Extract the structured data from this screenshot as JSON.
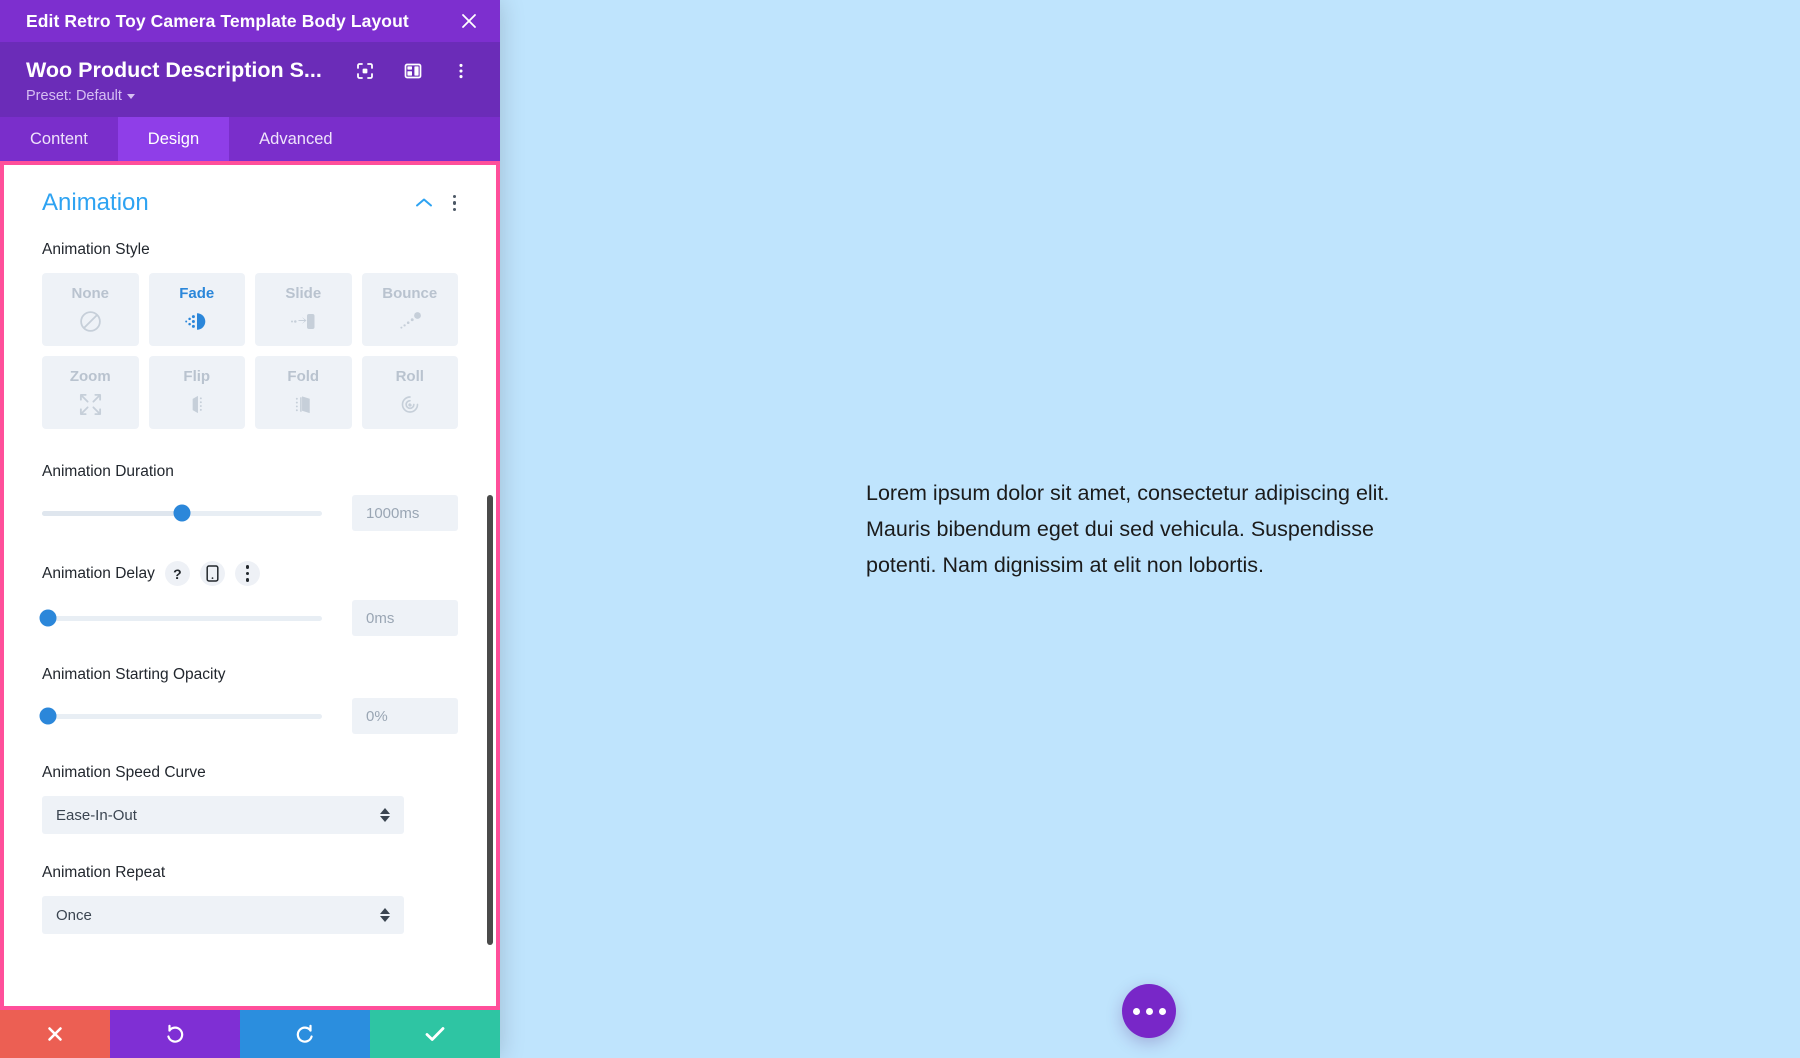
{
  "modal": {
    "topbar_title": "Edit Retro Toy Camera Template Body Layout",
    "close_icon": "close-icon",
    "module_title": "Woo Product Description S...",
    "preset_label": "Preset: Default",
    "head_icons": [
      {
        "name": "fullscreen-icon"
      },
      {
        "name": "layout-columns-icon"
      },
      {
        "name": "kebab-menu-icon"
      }
    ],
    "tabs": [
      {
        "label": "Content",
        "active": false
      },
      {
        "label": "Design",
        "active": true
      },
      {
        "label": "Advanced",
        "active": false
      }
    ]
  },
  "panel": {
    "section_title": "Animation",
    "collapse_icon": "chevron-up-icon",
    "section_menu_icon": "kebab-menu-icon",
    "animation_style": {
      "label": "Animation Style",
      "selected": "Fade",
      "options": [
        {
          "label": "None",
          "icon": "no-entry-icon",
          "selected": false
        },
        {
          "label": "Fade",
          "icon": "fade-icon",
          "selected": true
        },
        {
          "label": "Slide",
          "icon": "slide-icon",
          "selected": false
        },
        {
          "label": "Bounce",
          "icon": "bounce-icon",
          "selected": false
        },
        {
          "label": "Zoom",
          "icon": "zoom-arrows-icon",
          "selected": false
        },
        {
          "label": "Flip",
          "icon": "flip-icon",
          "selected": false
        },
        {
          "label": "Fold",
          "icon": "fold-icon",
          "selected": false
        },
        {
          "label": "Roll",
          "icon": "roll-icon",
          "selected": false
        }
      ]
    },
    "duration": {
      "label": "Animation Duration",
      "value": "1000ms",
      "slider_percent": 50
    },
    "delay": {
      "label": "Animation Delay",
      "value": "0ms",
      "slider_percent": 0,
      "badges": [
        {
          "name": "help-icon",
          "glyph": "?"
        },
        {
          "name": "responsive-phone-icon",
          "glyph": ""
        },
        {
          "name": "kebab-menu-icon",
          "glyph": ""
        }
      ]
    },
    "starting_opacity": {
      "label": "Animation Starting Opacity",
      "value": "0%",
      "slider_percent": 0
    },
    "speed_curve": {
      "label": "Animation Speed Curve",
      "value": "Ease-In-Out"
    },
    "repeat": {
      "label": "Animation Repeat",
      "value": "Once"
    }
  },
  "actions": [
    {
      "name": "cancel-button",
      "icon": "x-icon",
      "color": "#ec5f53"
    },
    {
      "name": "undo-button",
      "icon": "undo-icon",
      "color": "#7f2fd4"
    },
    {
      "name": "redo-button",
      "icon": "redo-icon",
      "color": "#2b8ede"
    },
    {
      "name": "save-button",
      "icon": "check-icon",
      "color": "#2ec5a3"
    }
  ],
  "canvas": {
    "paragraph": "Lorem ipsum dolor sit amet, consectetur adipiscing elit. Mauris bibendum eget dui sed vehicula. Suspendisse potenti. Nam dignissim at elit non lobortis.",
    "fab_icon": "ellipsis-icon",
    "background_color": "#bfe4fd"
  }
}
